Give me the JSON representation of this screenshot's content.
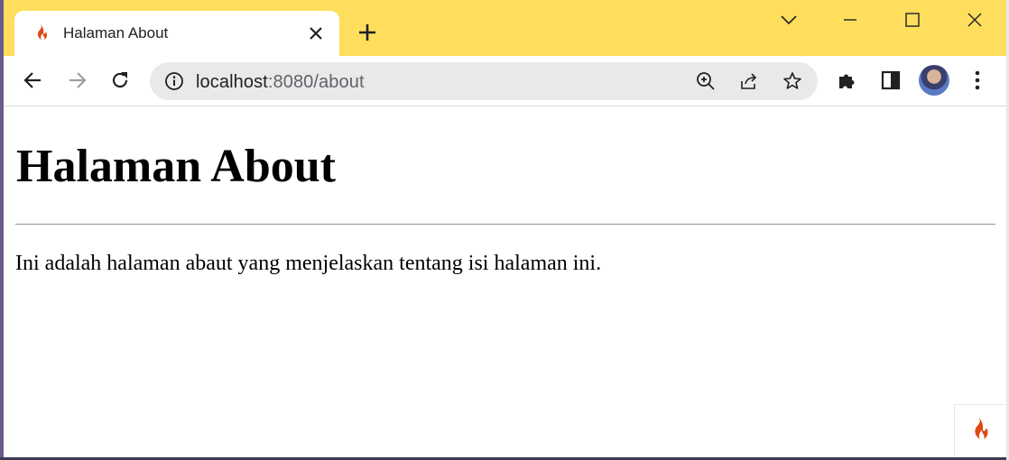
{
  "browser": {
    "tab": {
      "title": "Halaman About"
    },
    "address": {
      "host": "localhost",
      "path": ":8080/about"
    }
  },
  "page": {
    "heading": "Halaman About",
    "paragraph": "Ini adalah halaman abaut yang menjelaskan tentang isi halaman ini."
  },
  "colors": {
    "titlebar": "#ffde5e",
    "codeigniter_flame": "#dd4814"
  },
  "icons": {
    "favicon": "codeigniter-flame-icon",
    "badge": "codeigniter-flame-icon"
  }
}
